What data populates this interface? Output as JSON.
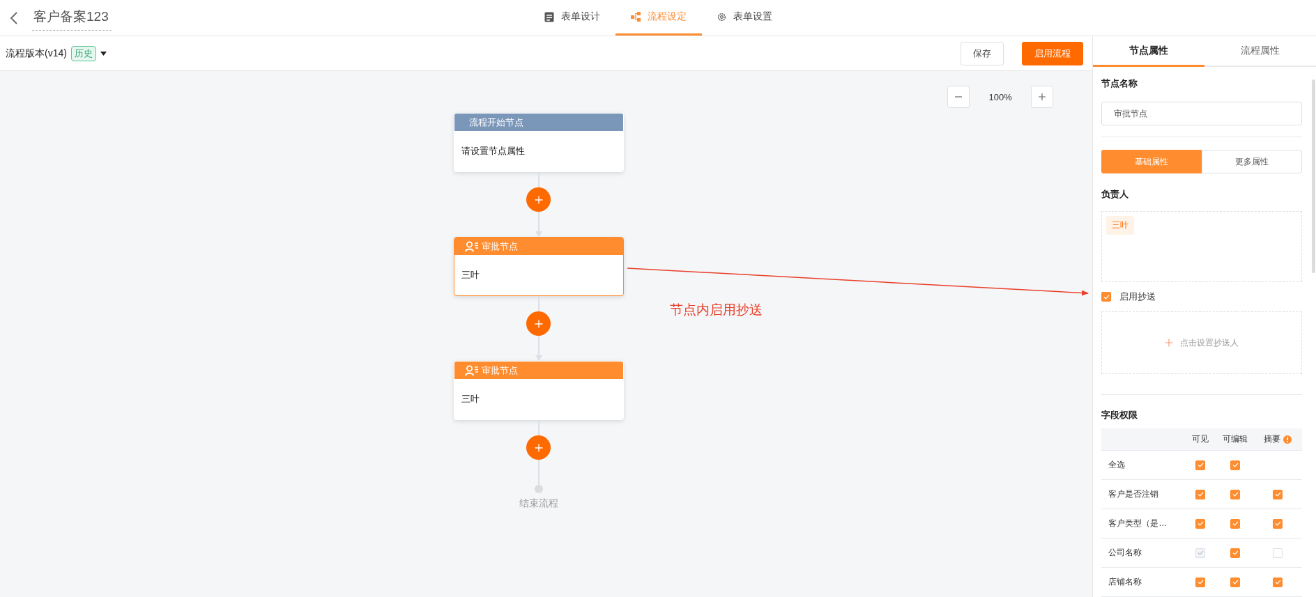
{
  "header": {
    "title": "客户备案123",
    "tabs": [
      {
        "label": "表单设计",
        "selected": false
      },
      {
        "label": "流程设定",
        "selected": true
      },
      {
        "label": "表单设置",
        "selected": false
      }
    ]
  },
  "toolbar": {
    "version": "流程版本(v14)",
    "badge": "历史",
    "buttons": [
      {
        "label": "保存",
        "primary": false
      },
      {
        "label": "启用流程",
        "primary": true
      }
    ]
  },
  "canvas": {
    "zoom": "100%",
    "nodes": [
      {
        "kind": "start",
        "title": "流程开始节点",
        "body": "请设置节点属性",
        "selected": false
      },
      {
        "kind": "approval",
        "title": "审批节点",
        "body": "三叶",
        "selected": true
      },
      {
        "kind": "approval",
        "title": "审批节点",
        "body": "三叶",
        "selected": false
      }
    ],
    "end": "结束流程",
    "annotation": "节点内启用抄送"
  },
  "panel": {
    "tabs": [
      {
        "label": "节点属性",
        "selected": true
      },
      {
        "label": "流程属性",
        "selected": false
      }
    ],
    "node_name": {
      "label": "节点名称",
      "value": "审批节点"
    },
    "subtabs": [
      {
        "label": "基础属性",
        "selected": true
      },
      {
        "label": "更多属性",
        "selected": false
      }
    ],
    "owner": {
      "label": "负责人",
      "tags": [
        "三叶"
      ]
    },
    "cc": {
      "label": "启用抄送",
      "checked": true,
      "add_label": "点击设置抄送人"
    },
    "permissions": {
      "title": "字段权限",
      "columns": [
        "可见",
        "可编辑",
        "摘要"
      ],
      "rows": [
        {
          "name": "全选",
          "visible": {
            "checked": true,
            "disabled": false
          },
          "editable": {
            "checked": true,
            "disabled": false
          }
        },
        {
          "name": "客户是否注销",
          "visible": {
            "checked": true,
            "disabled": false
          },
          "editable": {
            "checked": true,
            "disabled": false
          },
          "summary": {
            "checked": true,
            "disabled": false
          }
        },
        {
          "name": "客户类型（是…",
          "visible": {
            "checked": true,
            "disabled": false
          },
          "editable": {
            "checked": true,
            "disabled": false
          },
          "summary": {
            "checked": true,
            "disabled": false
          }
        },
        {
          "name": "公司名称",
          "visible": {
            "checked": true,
            "disabled": true
          },
          "editable": {
            "checked": true,
            "disabled": false
          },
          "summary": {
            "checked": false,
            "disabled": false
          }
        },
        {
          "name": "店铺名称",
          "visible": {
            "checked": true,
            "disabled": false
          },
          "editable": {
            "checked": true,
            "disabled": false
          },
          "summary": {
            "checked": true,
            "disabled": false
          }
        }
      ]
    }
  }
}
